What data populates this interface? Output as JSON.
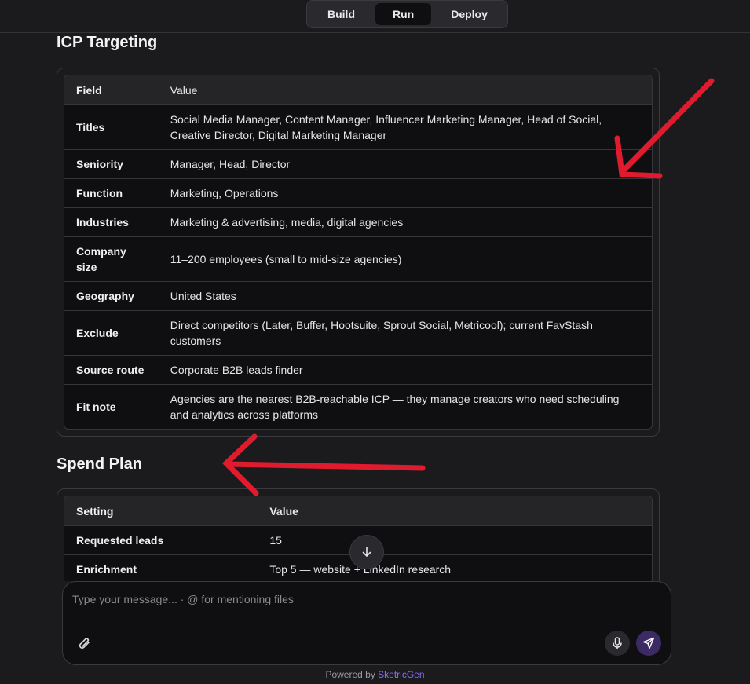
{
  "modes": [
    "Build",
    "Run",
    "Deploy"
  ],
  "active_mode": "Run",
  "icp": {
    "title": "ICP Targeting",
    "header": {
      "field": "Field",
      "value": "Value"
    },
    "rows": [
      {
        "field": "Titles",
        "value": "Social Media Manager, Content Manager, Influencer Marketing Manager, Head of Social, Creative Director, Digital Marketing Manager"
      },
      {
        "field": "Seniority",
        "value": "Manager, Head, Director"
      },
      {
        "field": "Function",
        "value": "Marketing, Operations"
      },
      {
        "field": "Industries",
        "value": "Marketing & advertising, media, digital agencies"
      },
      {
        "field": "Company size",
        "value": "11–200 employees (small to mid-size agencies)"
      },
      {
        "field": "Geography",
        "value": "United States"
      },
      {
        "field": "Exclude",
        "value": "Direct competitors (Later, Buffer, Hootsuite, Sprout Social, Metricool); current FavStash customers"
      },
      {
        "field": "Source route",
        "value": "Corporate B2B leads finder"
      },
      {
        "field": "Fit note",
        "value": "Agencies are the nearest B2B-reachable ICP — they manage creators who need scheduling and analytics across platforms"
      }
    ]
  },
  "spend": {
    "title": "Spend Plan",
    "header": {
      "setting": "Setting",
      "value": "Value"
    },
    "rows": [
      {
        "setting": "Requested leads",
        "value": "15"
      },
      {
        "setting": "Enrichment",
        "value": "Top 5 — website + LinkedIn research"
      }
    ]
  },
  "composer": {
    "placeholder": "Type your message... · @ for mentioning files"
  },
  "footer": {
    "powered_by": "Powered by",
    "brand": "SketricGen"
  },
  "icons": {
    "scroll": "arrow-down-icon",
    "attach": "paperclip-icon",
    "mic": "microphone-icon",
    "send": "send-icon"
  },
  "colors": {
    "background": "#1b1b1e",
    "accent": "#8b6cf0",
    "annotation": "#e01b2e"
  }
}
